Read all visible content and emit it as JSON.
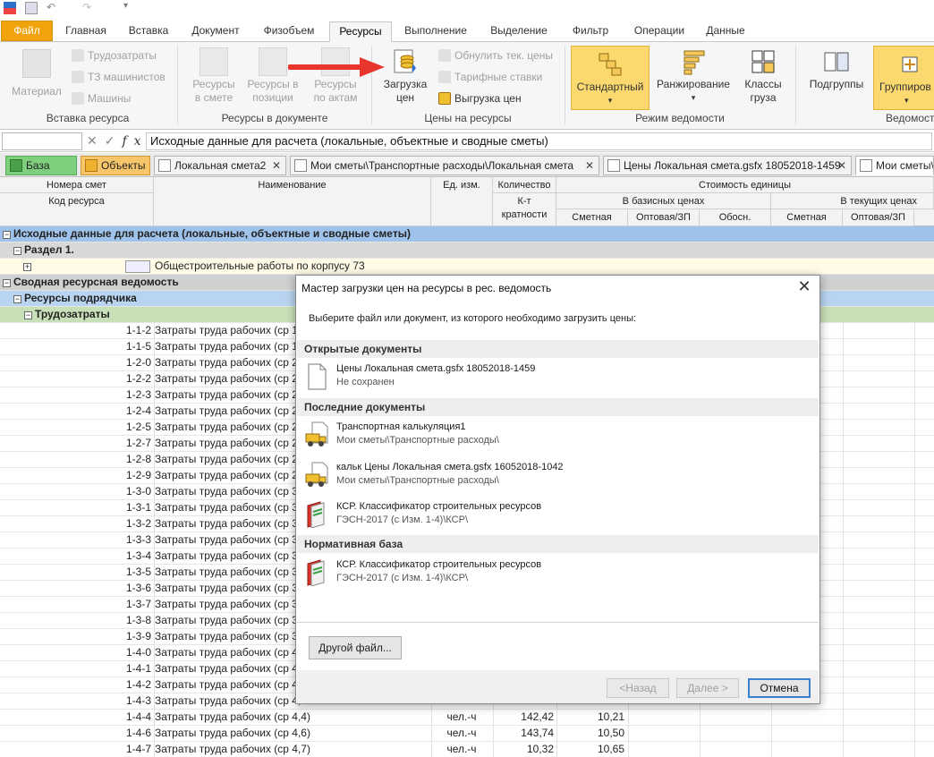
{
  "ribbon_tabs": [
    "Файл",
    "Главная",
    "Вставка",
    "Документ",
    "Физобъем",
    "Ресурсы",
    "Выполнение",
    "Выделение",
    "Фильтр",
    "Операции",
    "Данные"
  ],
  "ribbon": {
    "insert_group": {
      "label": "Вставка ресурса",
      "material": "Материал",
      "items": [
        "Трудозатраты",
        "ТЗ машинистов",
        "Машины"
      ]
    },
    "doc_group": {
      "label": "Ресурсы в документе",
      "btn1": [
        "Ресурсы",
        "в смете"
      ],
      "btn2": [
        "Ресурсы в",
        "позиции"
      ],
      "btn3": [
        "Ресурсы",
        "по актам"
      ]
    },
    "price_group": {
      "label": "Цены на ресурсы",
      "load": [
        "Загрузка",
        "цен"
      ],
      "items": [
        "Обнулить тек. цены",
        "Тарифные ставки",
        "Выгрузка цен"
      ]
    },
    "mode_group": {
      "label": "Режим ведомости",
      "standard": "Стандартный",
      "ranking": "Ранжирование",
      "classes": [
        "Классы",
        "груза"
      ]
    },
    "subgroups": "Подгруппы",
    "grouping": "Группиров",
    "view_label": "Ведомость"
  },
  "formula_bar": {
    "text": "Исходные данные для расчета (локальные, объектные и сводные сметы)"
  },
  "doc_tabs": [
    {
      "label": "База"
    },
    {
      "label": "Объекты"
    },
    {
      "label": "Локальная смета2"
    },
    {
      "label": "Мои сметы\\Транспортные расходы\\Локальная смета"
    },
    {
      "label": "Цены Локальная смета.gsfx 18052018-1459"
    },
    {
      "label": "Мои сметы\\"
    }
  ],
  "grid_header": {
    "numbers": "Номера смет",
    "code": "Код ресурса",
    "name": "Наименование",
    "unit": "Ед. изм.",
    "qty": "Количество",
    "coef": [
      "К-т",
      "кратности"
    ],
    "unit_cost": "Стоимость единицы",
    "base": "В базисных ценах",
    "current": "В текущих ценах",
    "smetnaya": "Сметная",
    "wholesale": "Оптовая/ЗП",
    "justif": "Обосн.",
    "smetnaya2": "Сметная",
    "wholesale2": "Оптовая/ЗП"
  },
  "grid_groups": {
    "g1": "Исходные данные для расчета (локальные, объектные и сводные сметы)",
    "g2": "Раздел 1.",
    "g3": "Общестроительные работы по корпусу 73",
    "g4": "Сводная ресурсная ведомость",
    "g5": "Ресурсы подрядчика",
    "g6": "Трудозатраты"
  },
  "rows": [
    {
      "code": "1-1-2",
      "name": "Затраты труда рабочих (ср 1,2",
      "unit": "",
      "qty": "",
      "sm": ""
    },
    {
      "code": "1-1-5",
      "name": "Затраты труда рабочих (ср 1,5",
      "unit": "",
      "qty": "",
      "sm": ""
    },
    {
      "code": "1-2-0",
      "name": "Затраты труда рабочих (ср 2)",
      "unit": "",
      "qty": "",
      "sm": ""
    },
    {
      "code": "1-2-2",
      "name": "Затраты труда рабочих (ср 2,2",
      "unit": "",
      "qty": "",
      "sm": ""
    },
    {
      "code": "1-2-3",
      "name": "Затраты труда рабочих (ср 2,3",
      "unit": "",
      "qty": "",
      "sm": ""
    },
    {
      "code": "1-2-4",
      "name": "Затраты труда рабочих (ср 2,4",
      "unit": "",
      "qty": "",
      "sm": ""
    },
    {
      "code": "1-2-5",
      "name": "Затраты труда рабочих (ср 2,5",
      "unit": "",
      "qty": "",
      "sm": ""
    },
    {
      "code": "1-2-7",
      "name": "Затраты труда рабочих (ср 2,7",
      "unit": "",
      "qty": "",
      "sm": ""
    },
    {
      "code": "1-2-8",
      "name": "Затраты труда рабочих (ср 2,8",
      "unit": "",
      "qty": "",
      "sm": ""
    },
    {
      "code": "1-2-9",
      "name": "Затраты труда рабочих (ср 2,9",
      "unit": "",
      "qty": "",
      "sm": ""
    },
    {
      "code": "1-3-0",
      "name": "Затраты труда рабочих (ср 3)",
      "unit": "",
      "qty": "",
      "sm": ""
    },
    {
      "code": "1-3-1",
      "name": "Затраты труда рабочих (ср 3,",
      "unit": "",
      "qty": "",
      "sm": ""
    },
    {
      "code": "1-3-2",
      "name": "Затраты труда рабочих (ср 3,2",
      "unit": "",
      "qty": "",
      "sm": ""
    },
    {
      "code": "1-3-3",
      "name": "Затраты труда рабочих (ср 3,3",
      "unit": "",
      "qty": "",
      "sm": ""
    },
    {
      "code": "1-3-4",
      "name": "Затраты труда рабочих (ср 3,4",
      "unit": "",
      "qty": "",
      "sm": ""
    },
    {
      "code": "1-3-5",
      "name": "Затраты труда рабочих (ср 3,5",
      "unit": "",
      "qty": "",
      "sm": ""
    },
    {
      "code": "1-3-6",
      "name": "Затраты труда рабочих (ср 3,6",
      "unit": "",
      "qty": "",
      "sm": ""
    },
    {
      "code": "1-3-7",
      "name": "Затраты труда рабочих (ср 3,7",
      "unit": "",
      "qty": "",
      "sm": ""
    },
    {
      "code": "1-3-8",
      "name": "Затраты труда рабочих (ср 3,8",
      "unit": "",
      "qty": "",
      "sm": ""
    },
    {
      "code": "1-3-9",
      "name": "Затраты труда рабочих (ср 3,9",
      "unit": "",
      "qty": "",
      "sm": ""
    },
    {
      "code": "1-4-0",
      "name": "Затраты труда рабочих (ср 4)",
      "unit": "",
      "qty": "",
      "sm": ""
    },
    {
      "code": "1-4-1",
      "name": "Затраты труда рабочих (ср 4,",
      "unit": "",
      "qty": "",
      "sm": ""
    },
    {
      "code": "1-4-2",
      "name": "Затраты труда рабочих (ср 4,2",
      "unit": "",
      "qty": "",
      "sm": ""
    },
    {
      "code": "1-4-3",
      "name": "Затраты труда рабочих (ср 4,3",
      "unit": "",
      "qty": "",
      "sm": ""
    },
    {
      "code": "1-4-4",
      "name": "Затраты труда рабочих (ср 4,4)",
      "unit": "чел.-ч",
      "qty": "142,42",
      "sm": "10,21"
    },
    {
      "code": "1-4-6",
      "name": "Затраты труда рабочих (ср 4,6)",
      "unit": "чел.-ч",
      "qty": "143,74",
      "sm": "10,50"
    },
    {
      "code": "1-4-7",
      "name": "Затраты труда рабочих (ср 4,7)",
      "unit": "чел.-ч",
      "qty": "10,32",
      "sm": "10,65"
    }
  ],
  "dialog": {
    "title": "Мастер загрузки цен на ресурсы в рес. ведомость",
    "prompt": "Выберите файл или документ, из которого необходимо загрузить цены:",
    "open_section": "Открытые документы",
    "open_docs": [
      {
        "name": "Цены Локальная смета.gsfx 18052018-1459",
        "path": "Не сохранен"
      }
    ],
    "recent_section": "Последние документы",
    "recent_docs": [
      {
        "name": "Транспортная калькуляция1",
        "path": "Мои сметы\\Транспортные расходы\\"
      },
      {
        "name": "кальк Цены Локальная смета.gsfx 16052018-1042",
        "path": "Мои сметы\\Транспортные расходы\\"
      },
      {
        "name": "КСР. Классификатор строительных ресурсов",
        "path": "ГЭСН-2017 (с Изм. 1-4)\\КСР\\"
      }
    ],
    "norm_section": "Нормативная база",
    "norm_docs": [
      {
        "name": "КСР. Классификатор строительных ресурсов",
        "path": "ГЭСН-2017 (с Изм. 1-4)\\КСР\\"
      }
    ],
    "other_file": "Другой файл...",
    "back": "<Назад",
    "next": "Далее >",
    "cancel": "Отмена"
  },
  "colors": {
    "file_tab": "#f0a30a",
    "selected_button": "#fcd96f",
    "group_blue": "#9fc2ea",
    "group_green": "#c8e0b8",
    "arrow": "#e8362d"
  }
}
